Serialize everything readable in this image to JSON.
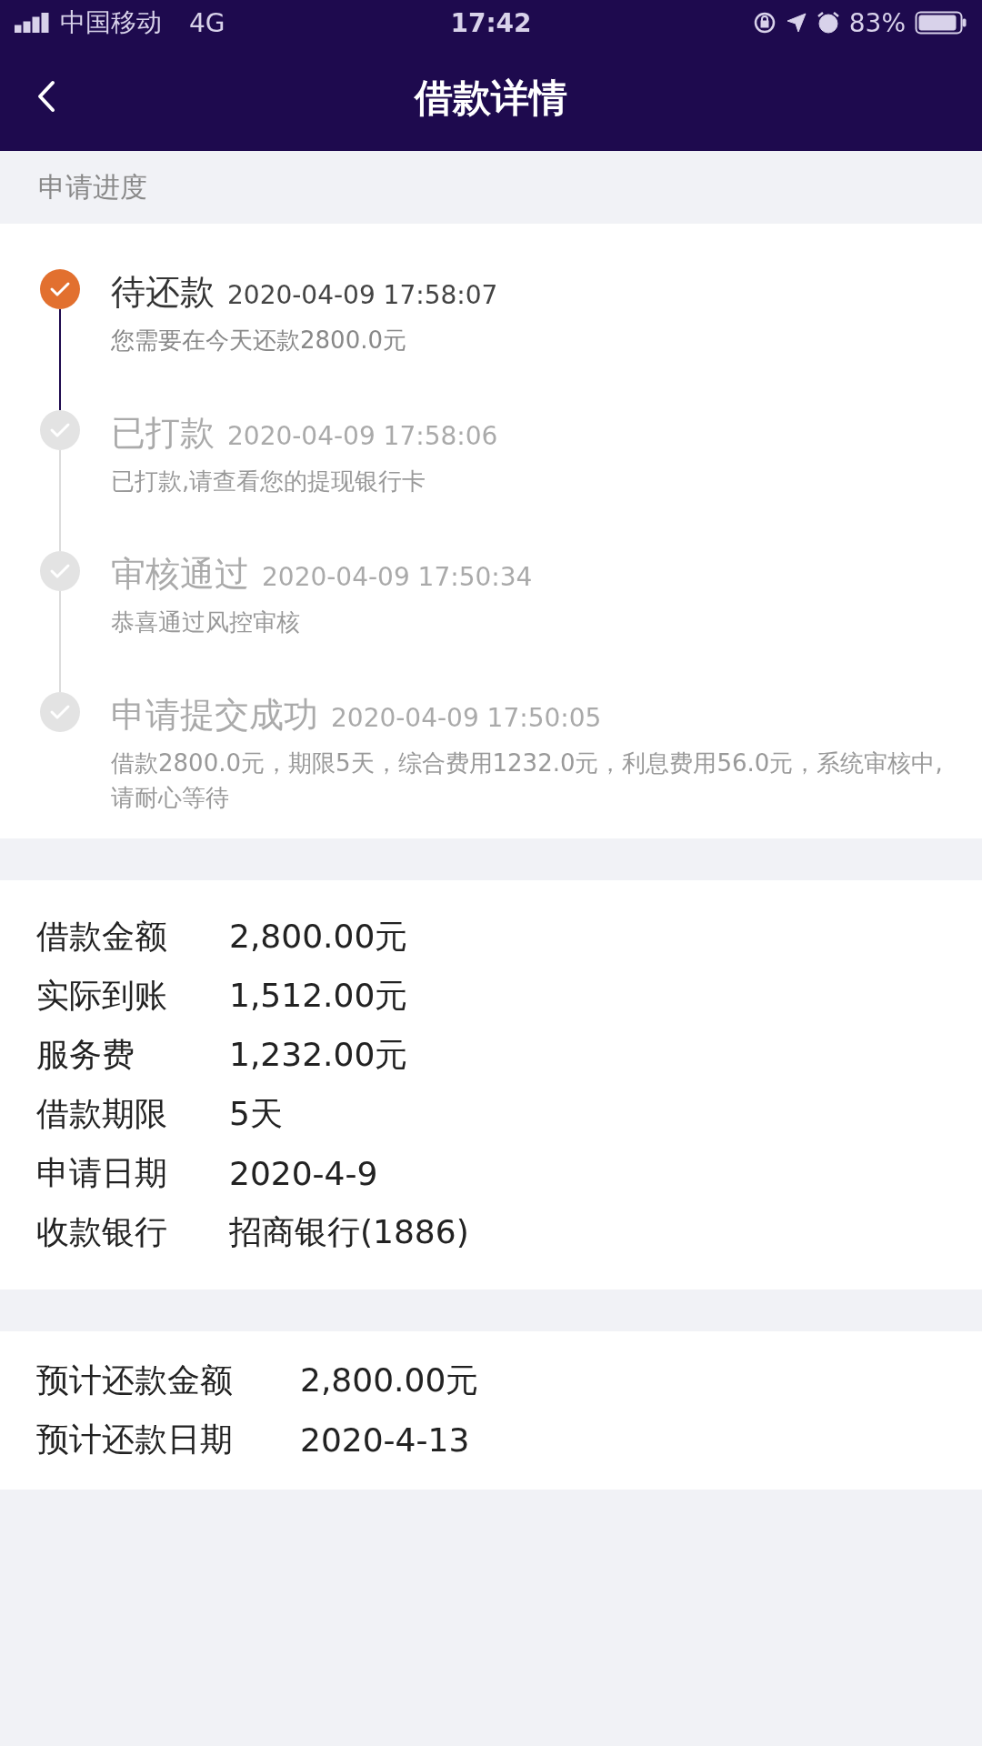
{
  "status_bar": {
    "carrier": "中国移动",
    "network": "4G",
    "time": "17:42",
    "battery": "83%"
  },
  "header": {
    "title": "借款详情"
  },
  "progress": {
    "heading": "申请进度",
    "steps": [
      {
        "title": "待还款",
        "time": "2020-04-09 17:58:07",
        "note": "您需要在今天还款2800.0元",
        "current": true
      },
      {
        "title": "已打款",
        "time": "2020-04-09 17:58:06",
        "note": "已打款,请查看您的提现银行卡",
        "current": false
      },
      {
        "title": "审核通过",
        "time": "2020-04-09 17:50:34",
        "note": "恭喜通过风控审核",
        "current": false
      },
      {
        "title": "申请提交成功",
        "time": "2020-04-09 17:50:05",
        "note": "借款2800.0元，期限5天，综合费用1232.0元，利息费用56.0元，系统审核中,请耐心等待",
        "current": false
      }
    ]
  },
  "details": [
    {
      "label": "借款金额",
      "value": "2,800.00元"
    },
    {
      "label": "实际到账",
      "value": "1,512.00元"
    },
    {
      "label": "服务费",
      "value": "1,232.00元"
    },
    {
      "label": "借款期限",
      "value": "5天"
    },
    {
      "label": "申请日期",
      "value": "2020-4-9"
    },
    {
      "label": "收款银行",
      "value": "招商银行(1886)"
    }
  ],
  "repayment": [
    {
      "label": "预计还款金额",
      "value": "2,800.00元"
    },
    {
      "label": "预计还款日期",
      "value": "2020-4-13"
    }
  ]
}
